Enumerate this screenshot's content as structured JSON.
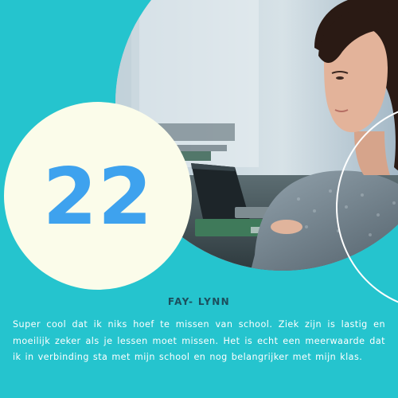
{
  "number": "22",
  "name": "FAY- LYNN",
  "quote": "Super cool dat ik niks hoef te missen van school. Ziek zijn is lastig en moeilijk zeker als je lessen moet missen. Het is echt een meerwaarde dat ik in verbinding sta met mijn school en nog belangrijker met mijn klas.",
  "colors": {
    "background": "#25c4ce",
    "circle": "#fbfcea",
    "number": "#3ea2ee",
    "name": "#1c4f5d",
    "quote_text": "#ffffff"
  }
}
